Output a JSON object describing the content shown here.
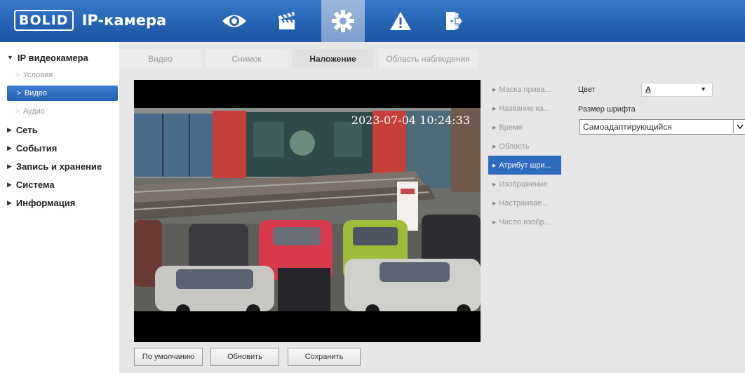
{
  "header": {
    "logo": "BOLID",
    "title": "IP-камера",
    "nav": [
      {
        "icon": "eye-icon"
      },
      {
        "icon": "clapperboard-icon"
      },
      {
        "icon": "gear-icon",
        "active": true
      },
      {
        "icon": "warning-icon"
      },
      {
        "icon": "exit-icon"
      }
    ]
  },
  "sidebar": {
    "ip_camera": "IP видеокамера",
    "conditions": "Условия",
    "video": "Видео",
    "audio": "Аудио",
    "network": "Сеть",
    "events": "События",
    "recording": "Запись и хранение",
    "system": "Система",
    "info": "Информация"
  },
  "tabs": [
    "Видео",
    "Снимок",
    "Наложение",
    "Область наблюдения"
  ],
  "active_tab": "Наложение",
  "video": {
    "timestamp": "2023-07-04 10:24:33"
  },
  "overlay_menu": [
    "Маска прива...",
    "Название ка...",
    "Время",
    "Область",
    "Атрибут шри...",
    "Изображение",
    "Настраивае...",
    "Число изобр..."
  ],
  "overlay_menu_active": "Атрибут шри...",
  "properties": {
    "color_label": "Цвет",
    "color_value": "A",
    "font_size_label": "Размер шрифта",
    "font_size_value": "Самоадаптирующийся"
  },
  "buttons": {
    "default": "По умолчанию",
    "refresh": "Обновить",
    "save": "Сохранить"
  },
  "colors": {
    "header_blue": "#2563b3",
    "active_blue": "#2e6cc0",
    "main_bg": "#e6e6e6"
  }
}
